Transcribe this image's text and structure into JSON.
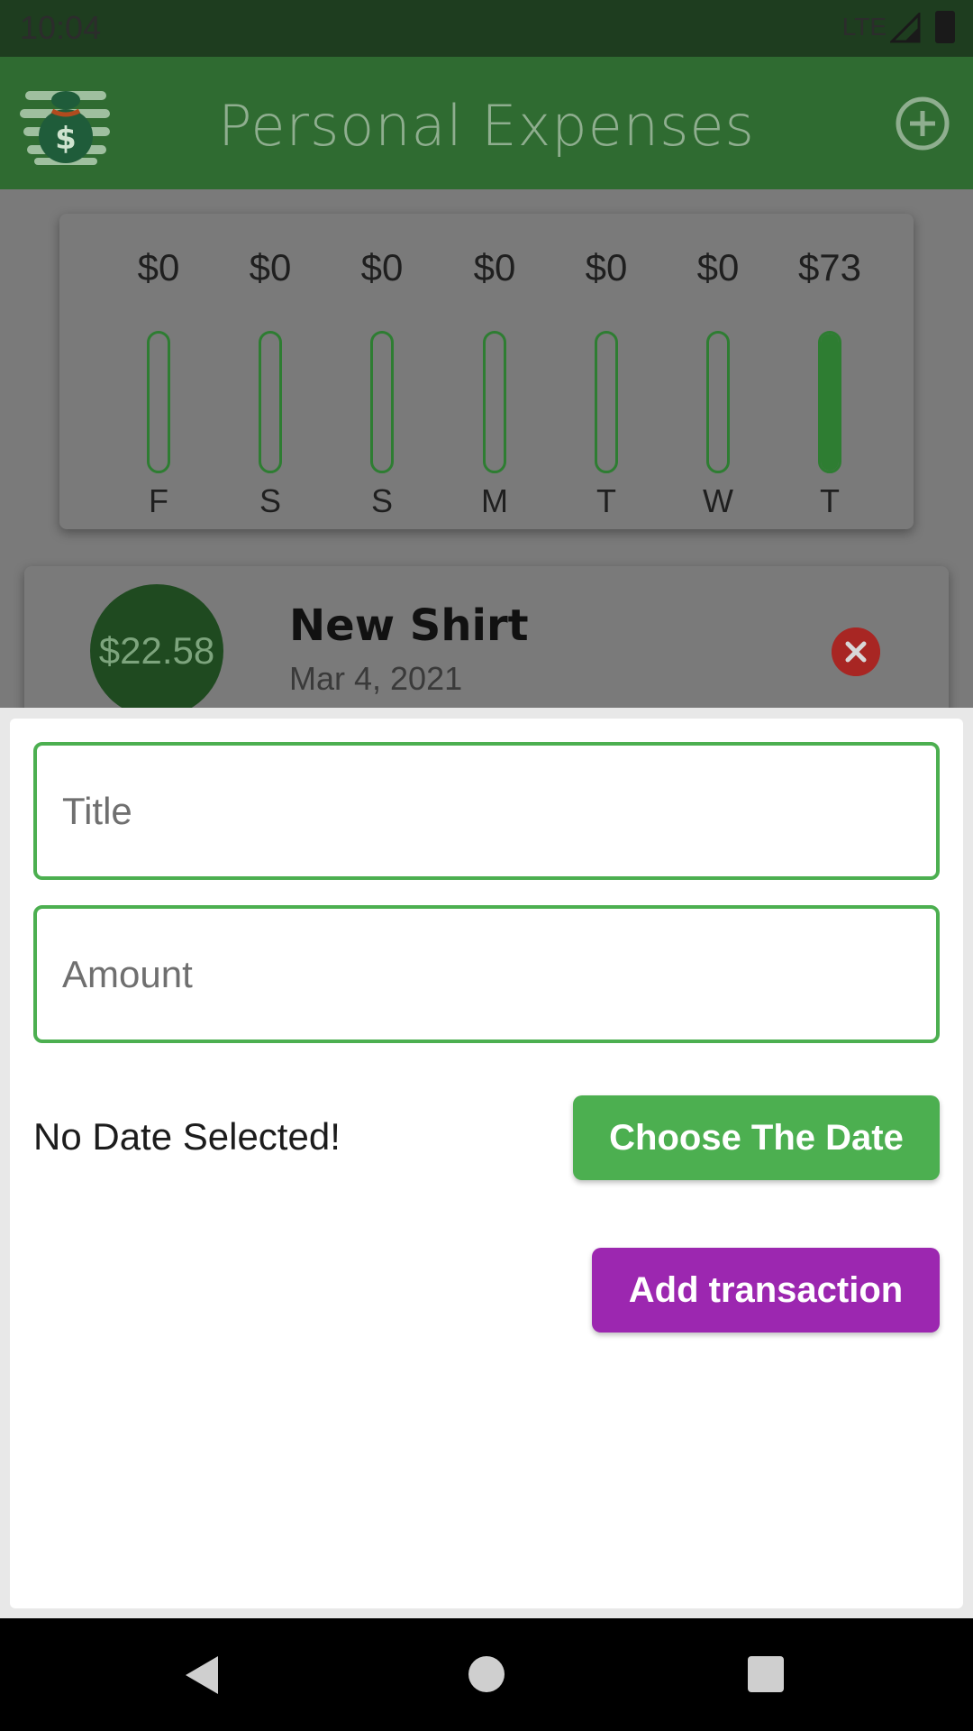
{
  "status_bar": {
    "time": "10:04",
    "network": "LTE"
  },
  "app_bar": {
    "title": "Personal Expenses",
    "logo_icon": "money-bag-icon",
    "add_icon": "plus-circle-icon"
  },
  "chart": {
    "bars": [
      {
        "day": "F",
        "amount": "$0",
        "fill": 0
      },
      {
        "day": "S",
        "amount": "$0",
        "fill": 0
      },
      {
        "day": "S",
        "amount": "$0",
        "fill": 0
      },
      {
        "day": "M",
        "amount": "$0",
        "fill": 0
      },
      {
        "day": "T",
        "amount": "$0",
        "fill": 0
      },
      {
        "day": "W",
        "amount": "$0",
        "fill": 0
      },
      {
        "day": "T",
        "amount": "$73",
        "fill": 1
      }
    ]
  },
  "transaction": {
    "amount": "$22.58",
    "title": "New Shirt",
    "date": "Mar 4, 2021",
    "delete_icon": "close-circle-icon"
  },
  "form": {
    "title_placeholder": "Title",
    "amount_placeholder": "Amount",
    "date_status": "No Date Selected!",
    "choose_date_label": "Choose The Date",
    "add_label": "Add transaction"
  },
  "colors": {
    "primary": "#4caf50",
    "accent": "#9c27b0",
    "danger": "#a82623",
    "app_bar": "#2f6b31"
  }
}
